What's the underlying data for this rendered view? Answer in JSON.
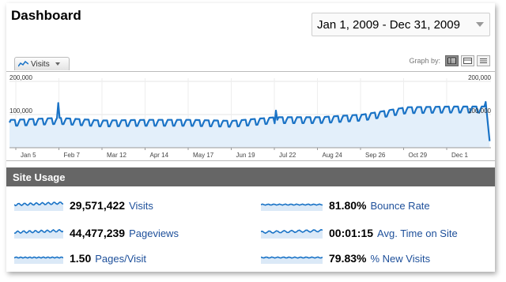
{
  "header": {
    "title": "Dashboard",
    "date_range": "Jan 1, 2009 - Dec 31, 2009"
  },
  "graph_controls": {
    "metric_tab": "Visits",
    "graph_by_label": "Graph by:",
    "options": [
      "day",
      "week",
      "month"
    ],
    "active_option": "day"
  },
  "chart_data": {
    "type": "line",
    "series": [
      {
        "name": "Visits"
      }
    ],
    "y_tick_labels_left": [
      "200,000",
      "100,000"
    ],
    "y_tick_labels_right": [
      "200,000",
      "100,000"
    ],
    "ylim": [
      0,
      200000
    ],
    "x_tick_labels": [
      "Jan 5",
      "Feb 7",
      "Mar 12",
      "Apr 14",
      "May 17",
      "Jun 19",
      "Jul 22",
      "Aug 24",
      "Sep 26",
      "Oct 29",
      "Dec 1"
    ],
    "trend": [
      {
        "date": "Jan 5",
        "visits": 80000
      },
      {
        "date": "Feb 7",
        "visits": 86000
      },
      {
        "date": "Mar 12",
        "visits": 78000
      },
      {
        "date": "Apr 14",
        "visits": 80000
      },
      {
        "date": "May 17",
        "visits": 80000
      },
      {
        "date": "Jun 19",
        "visits": 77000
      },
      {
        "date": "Jul 22",
        "visits": 88000
      },
      {
        "date": "Aug 24",
        "visits": 88000
      },
      {
        "date": "Sep 26",
        "visits": 96000
      },
      {
        "date": "Oct 29",
        "visits": 118000
      },
      {
        "date": "Dec 1",
        "visits": 120000
      }
    ],
    "spikes": [
      {
        "date": "Feb 7",
        "visits": 135000
      },
      {
        "date": "Jul 22",
        "visits": 112000
      },
      {
        "date": "Dec 28",
        "visits": 138000
      }
    ],
    "final_drop_visits": 20000,
    "color": "#1a73c6",
    "fill": "#e3effa",
    "grid": true
  },
  "site_usage": {
    "title": "Site Usage",
    "metrics": [
      {
        "value": "29,571,422",
        "label": "Visits"
      },
      {
        "value": "44,477,239",
        "label": "Pageviews"
      },
      {
        "value": "1.50",
        "label": "Pages/Visit"
      },
      {
        "value": "81.80%",
        "label": "Bounce Rate"
      },
      {
        "value": "00:01:15",
        "label": "Avg. Time on Site"
      },
      {
        "value": "79.83%",
        "label": "% New Visits"
      }
    ]
  }
}
